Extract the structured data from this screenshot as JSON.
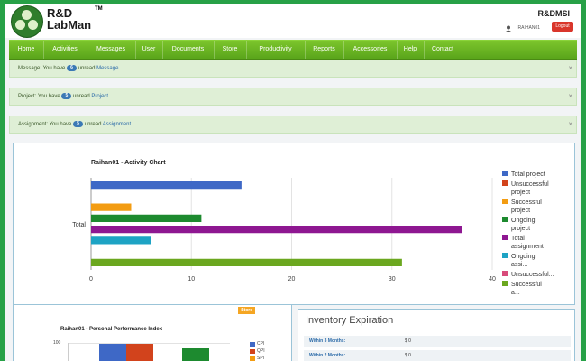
{
  "header": {
    "logo_line1": "R&D",
    "logo_line2": "LabMan",
    "logo_tm": "TM",
    "brand": "R&DMSI",
    "user": "RAIHAN01",
    "logout_label": "Logout"
  },
  "nav": [
    {
      "label": "Home"
    },
    {
      "label": "Activities"
    },
    {
      "label": "Messages"
    },
    {
      "label": "User"
    },
    {
      "label": "Documents"
    },
    {
      "label": "Store"
    },
    {
      "label": "Productivity"
    },
    {
      "label": "Reports"
    },
    {
      "label": "Accessories"
    },
    {
      "label": "Help"
    },
    {
      "label": "Contact"
    }
  ],
  "alerts": [
    {
      "prefix": "Message: You have",
      "count": "6",
      "middle": "unread",
      "link": "Message",
      "close": "×"
    },
    {
      "prefix": "Project: You have",
      "count": "5",
      "middle": "unread",
      "link": "Project",
      "close": "×"
    },
    {
      "prefix": "Assignment: You have",
      "count": "5",
      "middle": "unread",
      "link": "Assignment",
      "close": "×"
    }
  ],
  "chart_data": {
    "type": "bar",
    "orientation": "horizontal",
    "title": "Raihan01 - Activity Chart",
    "categories": [
      "Total"
    ],
    "xlim": [
      0,
      40
    ],
    "x_ticks": [
      "0",
      "10",
      "20",
      "30",
      "40"
    ],
    "grid": true,
    "legend_position": "right",
    "series": [
      {
        "name": "Total project",
        "values": [
          15
        ],
        "color": "#3e68c6"
      },
      {
        "name": "Unsuccessful project",
        "values": [
          0
        ],
        "color": "#d2431c"
      },
      {
        "name": "Successful project",
        "values": [
          4
        ],
        "color": "#f39c12"
      },
      {
        "name": "Ongoing project",
        "values": [
          11
        ],
        "color": "#1d8a2f"
      },
      {
        "name": "Total assignment",
        "values": [
          37
        ],
        "color": "#8e1791"
      },
      {
        "name": "Ongoing assi...",
        "values": [
          6
        ],
        "color": "#1ea3c4"
      },
      {
        "name": "Unsuccessful...",
        "values": [
          0
        ],
        "color": "#d84b7a"
      },
      {
        "name": "Successful a...",
        "values": [
          31
        ],
        "color": "#6ba71f"
      }
    ]
  },
  "ppi": {
    "store_tag": "Store",
    "title": "Raihan01 - Personal Performance Index",
    "tick": "100",
    "legend": [
      {
        "name": "CPI",
        "color": "#3e68c6"
      },
      {
        "name": "QPI",
        "color": "#d2431c"
      },
      {
        "name": "SPI",
        "color": "#f39c12"
      }
    ],
    "bars": [
      {
        "color": "#3e68c6"
      },
      {
        "color": "#d2431c"
      },
      {
        "color": "#1d8a2f"
      }
    ]
  },
  "inventory": {
    "title": "Inventory Expiration",
    "rows": [
      {
        "label": "Within 3 Months:",
        "value": "$ 0"
      },
      {
        "label": "Within 2 Months:",
        "value": "$ 0"
      }
    ]
  }
}
